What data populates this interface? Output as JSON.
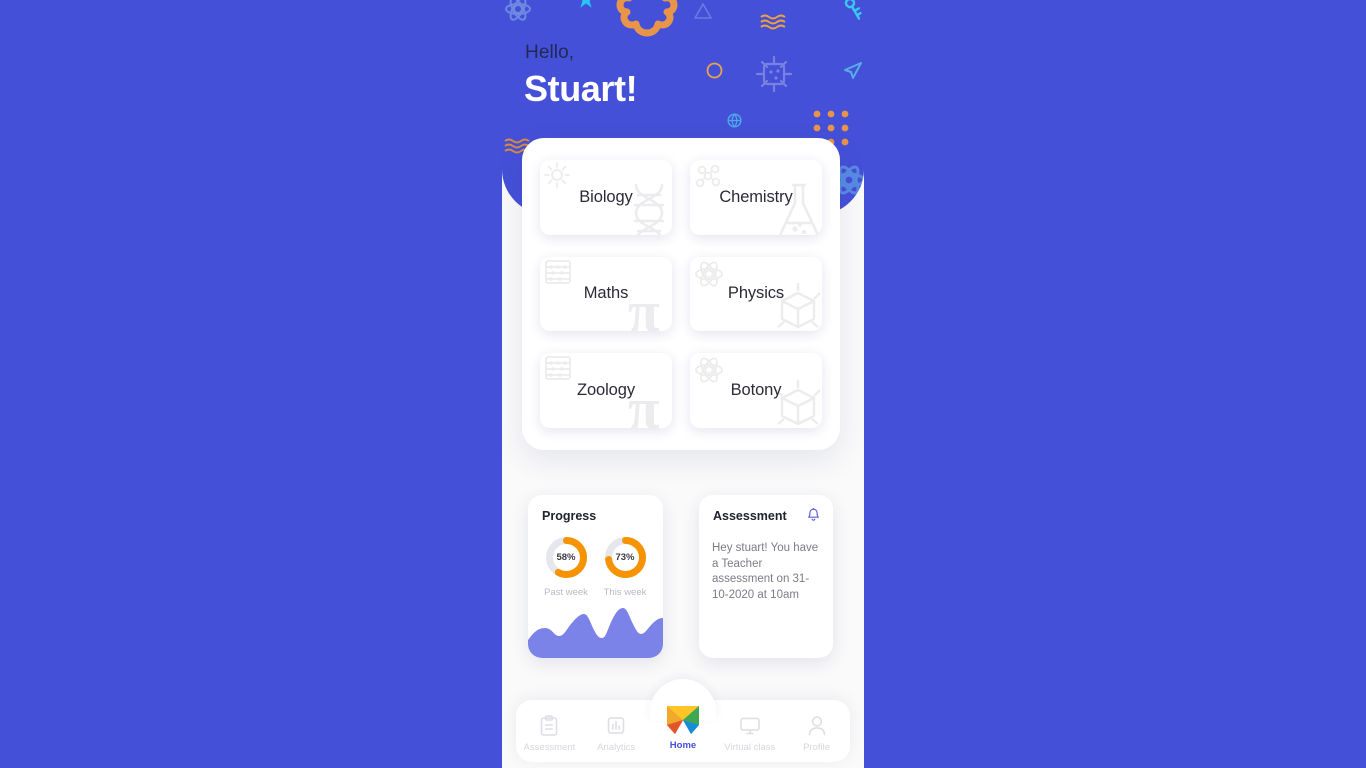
{
  "app": {
    "background_color": "#4550D8",
    "surface_color": "#FAFAFA"
  },
  "header": {
    "greeting": "Hello,",
    "user_name": "Stuart!",
    "background_color": "#4550D8",
    "greeting_color": "#222a52",
    "name_color": "#ffffff",
    "decorations": [
      "brain-icon",
      "atom-icon",
      "star-icon",
      "triangle-icon",
      "wave-lines-icon",
      "key-icon",
      "circle-outline-icon",
      "virus-icon",
      "paper-plane-icon",
      "globe-icon",
      "dot-grid-icon",
      "wave-lines-icon",
      "atom-icon"
    ]
  },
  "subjects": {
    "panel_name": "subject-panel",
    "items": [
      {
        "label": "Biology",
        "icon_tl": "sun-icon",
        "icon_br": "dna-icon"
      },
      {
        "label": "Chemistry",
        "icon_tl": "molecule-icon",
        "icon_br": "flask-icon"
      },
      {
        "label": "Maths",
        "icon_tl": "abacus-icon",
        "icon_br": "pi-icon"
      },
      {
        "label": "Physics",
        "icon_tl": "atom-icon",
        "icon_br": "cube-icon"
      },
      {
        "label": "Zoology",
        "icon_tl": "abacus-icon",
        "icon_br": "pi-icon"
      },
      {
        "label": "Botony",
        "icon_tl": "atom-icon",
        "icon_br": "cube-icon"
      }
    ]
  },
  "progress_card": {
    "title": "Progress",
    "accent_color": "#F59400",
    "track_color": "#E6E6ED",
    "wave_color": "#7B82E8"
  },
  "assessment_card": {
    "title": "Assessment",
    "bell_icon": "bell-icon",
    "bell_color": "#5c5fdb",
    "message": "Hey stuart! You have a Teacher assessment on 31-10-2020 at 10am"
  },
  "bottom_nav": {
    "active_color": "#4550D8",
    "inactive_color": "#d6d6dd",
    "items": [
      {
        "label": "Assessment",
        "icon": "clipboard-icon",
        "active": false
      },
      {
        "label": "Analytics",
        "icon": "bar-chart-icon",
        "active": false
      },
      {
        "label": "Home",
        "icon": "app-logo-icon",
        "active": true
      },
      {
        "label": "Virtual class",
        "icon": "monitor-icon",
        "active": false
      },
      {
        "label": "Profile",
        "icon": "person-icon",
        "active": false
      }
    ]
  },
  "chart_data": {
    "type": "pie",
    "title": "Progress",
    "charts": [
      {
        "label": "Past week",
        "value": 58,
        "display": "58%",
        "max": 100
      },
      {
        "label": "This week",
        "value": 73,
        "display": "73%",
        "max": 100
      }
    ],
    "sparkline": {
      "type": "area",
      "color": "#7B82E8",
      "x": [
        0,
        1,
        2,
        3,
        4,
        5,
        6,
        7,
        8
      ],
      "y": [
        42,
        58,
        38,
        86,
        40,
        96,
        46,
        34,
        72
      ],
      "ylim": [
        0,
        100
      ]
    }
  }
}
